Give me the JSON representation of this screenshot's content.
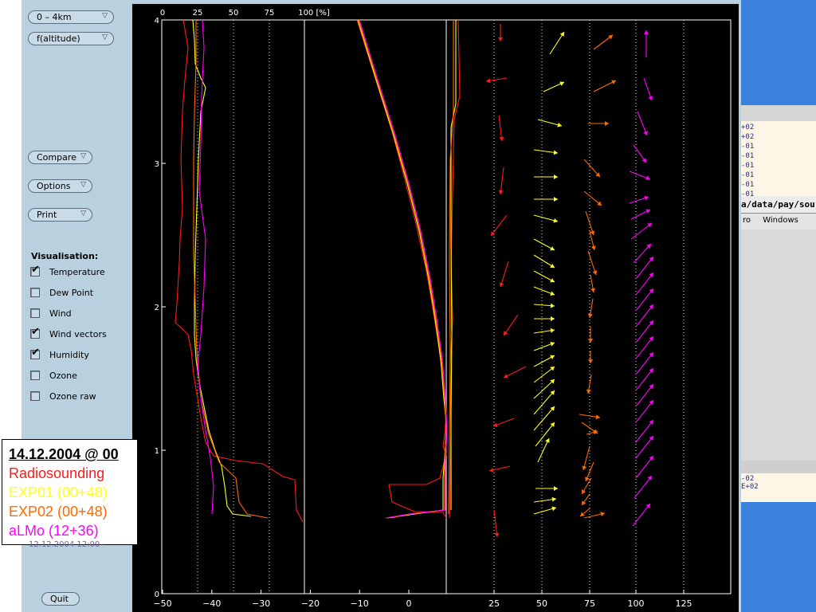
{
  "sidebar": {
    "range_select": "0 – 4km",
    "mode_select": "f(altitude)",
    "compare": "Compare",
    "options": "Options",
    "print": "Print",
    "quit": "Quit",
    "visualisation_title": "Visualisation:",
    "visualisation": [
      {
        "label": "Temperature",
        "checked": true
      },
      {
        "label": "Dew Point",
        "checked": false
      },
      {
        "label": "Wind",
        "checked": false
      },
      {
        "label": "Wind vectors",
        "checked": true
      },
      {
        "label": "Humidity",
        "checked": true
      },
      {
        "label": "Ozone",
        "checked": false
      },
      {
        "label": "Ozone raw",
        "checked": false
      }
    ]
  },
  "legend": {
    "date": "14.12.2004 @ 00",
    "entries": [
      {
        "label": "Radiosounding",
        "color": "#ff1a1a"
      },
      {
        "label": "EXP01 (00+48)",
        "color": "#ffff1a"
      },
      {
        "label": "EXP02 (00+48)",
        "color": "#ff6a00"
      },
      {
        "label": "aLMo (12+36)",
        "color": "#ff00ff"
      }
    ],
    "partial_below": "12.12.2004 12:00 -"
  },
  "plot": {
    "top_axis_ticks": [
      "0",
      "25",
      "50",
      "75",
      "100 [%]"
    ],
    "altitude_ticks": [
      "0",
      "1",
      "2",
      "3",
      "4"
    ],
    "temperature_ticks": [
      "−50",
      "−40",
      "−30",
      "−20",
      "−10",
      "0"
    ],
    "wind_ticks": [
      "25",
      "50",
      "75",
      "100",
      "125"
    ]
  },
  "background_window": {
    "values_top": [
      "+02",
      "+02",
      "-01",
      "-01",
      "-01",
      "-01",
      "-01",
      "-01"
    ],
    "path": "a/data/pay/sou",
    "menu": [
      "ro",
      "Windows"
    ],
    "values_bottom": [
      "-02",
      "E+02"
    ]
  },
  "colors": {
    "radiosounding": "#ff1a1a",
    "exp01": "#ffff1a",
    "exp02": "#ff6a00",
    "almo": "#ff00ff"
  }
}
